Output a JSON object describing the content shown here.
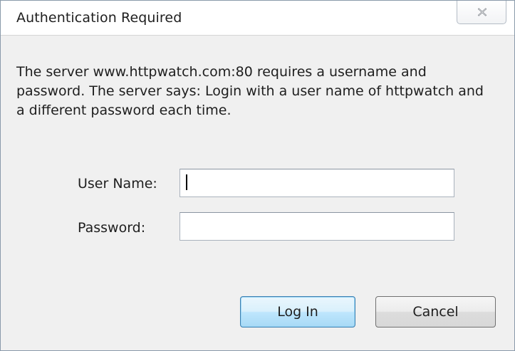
{
  "window": {
    "title": "Authentication Required"
  },
  "message": "The server www.httpwatch.com:80 requires a username and password. The server says: Login with a user name of httpwatch and a different password each time.",
  "form": {
    "username_label": "User Name:",
    "username_value": "",
    "password_label": "Password:",
    "password_value": ""
  },
  "buttons": {
    "login_label": "Log In",
    "cancel_label": "Cancel"
  },
  "icons": {
    "close": "close-icon"
  }
}
